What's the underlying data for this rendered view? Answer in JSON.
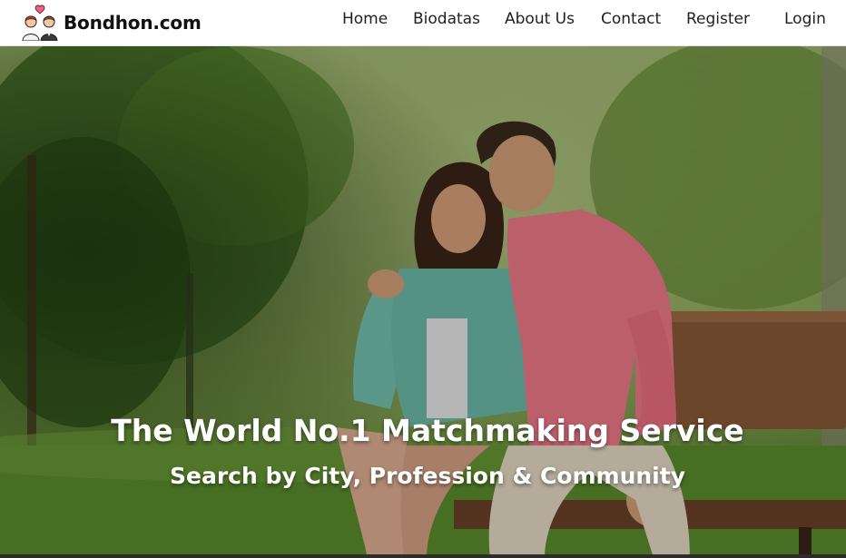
{
  "brand": {
    "name": "Bondhon.com",
    "logo_icon": "couple-heart-icon"
  },
  "nav": {
    "home": "Home",
    "biodatas": "Biodatas",
    "about": "About Us",
    "contact": "Contact",
    "register": "Register",
    "login": "Login"
  },
  "hero": {
    "title": "The World No.1 Matchmaking Service",
    "subtitle": "Search by City, Profession & Community",
    "image": "couple-on-park-bench-photo"
  },
  "colors": {
    "brand_text": "#111111",
    "nav_text": "#1f1f1f",
    "hero_text": "#ffffff",
    "heart": "#ff5c7a"
  }
}
